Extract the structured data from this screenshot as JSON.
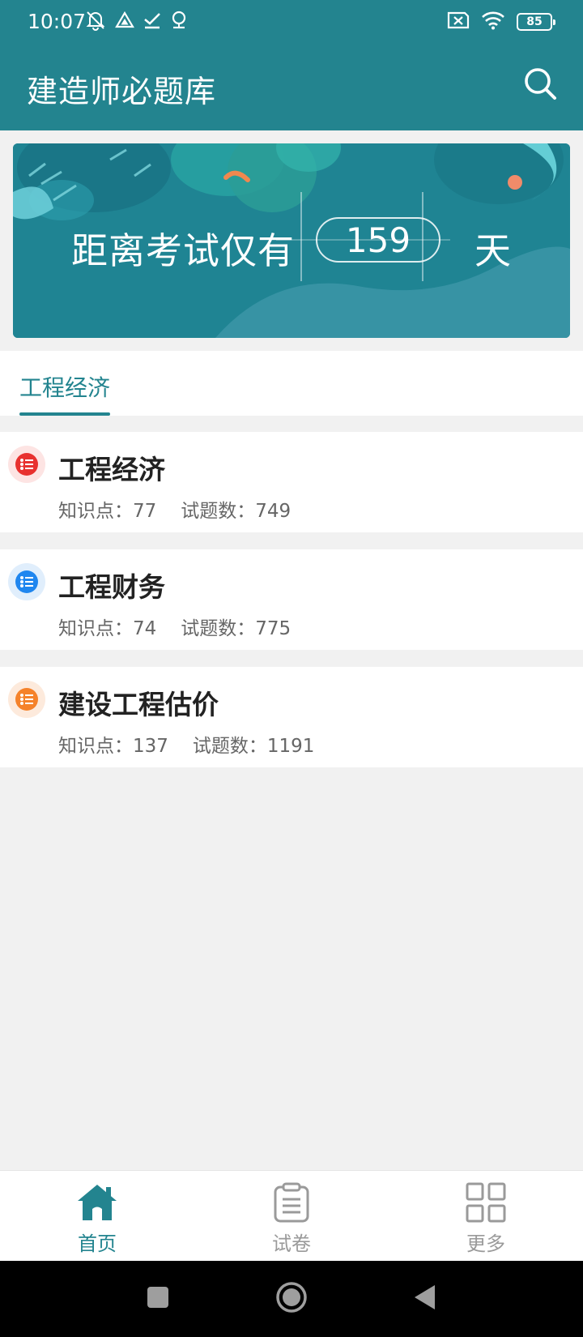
{
  "status_bar": {
    "time": "10:07",
    "battery": "85",
    "left_icons": [
      "mute-icon",
      "drive-icon",
      "check-icon",
      "location-icon"
    ],
    "right_icons": [
      "sim-off-icon",
      "wifi-icon",
      "battery-icon"
    ]
  },
  "app_bar": {
    "title": "建造师必题库",
    "search_icon": "search-icon"
  },
  "banner": {
    "prefix": "距离考试仅有",
    "days": "159",
    "suffix": "天"
  },
  "tabs": [
    {
      "label": "工程经济",
      "active": true
    }
  ],
  "subjects": [
    {
      "title": "工程经济",
      "knowledge_label": "知识点：",
      "knowledge_count": "77",
      "questions_label": "试题数：",
      "questions_count": "749",
      "icon_color": "#e8312f",
      "icon_bg": "#fde4e3"
    },
    {
      "title": "工程财务",
      "knowledge_label": "知识点：",
      "knowledge_count": "74",
      "questions_label": "试题数：",
      "questions_count": "775",
      "icon_color": "#1f86ef",
      "icon_bg": "#e0eefc"
    },
    {
      "title": "建设工程估价",
      "knowledge_label": "知识点：",
      "knowledge_count": "137",
      "questions_label": "试题数：",
      "questions_count": "1191",
      "icon_color": "#f5822a",
      "icon_bg": "#fdeadc"
    }
  ],
  "bottom_nav": [
    {
      "label": "首页",
      "icon": "home-icon",
      "active": true
    },
    {
      "label": "试卷",
      "icon": "clipboard-icon",
      "active": false
    },
    {
      "label": "更多",
      "icon": "grid-icon",
      "active": false
    }
  ],
  "colors": {
    "primary": "#23848f",
    "page_bg": "#f1f1f1",
    "inactive": "#9a9a9a"
  }
}
